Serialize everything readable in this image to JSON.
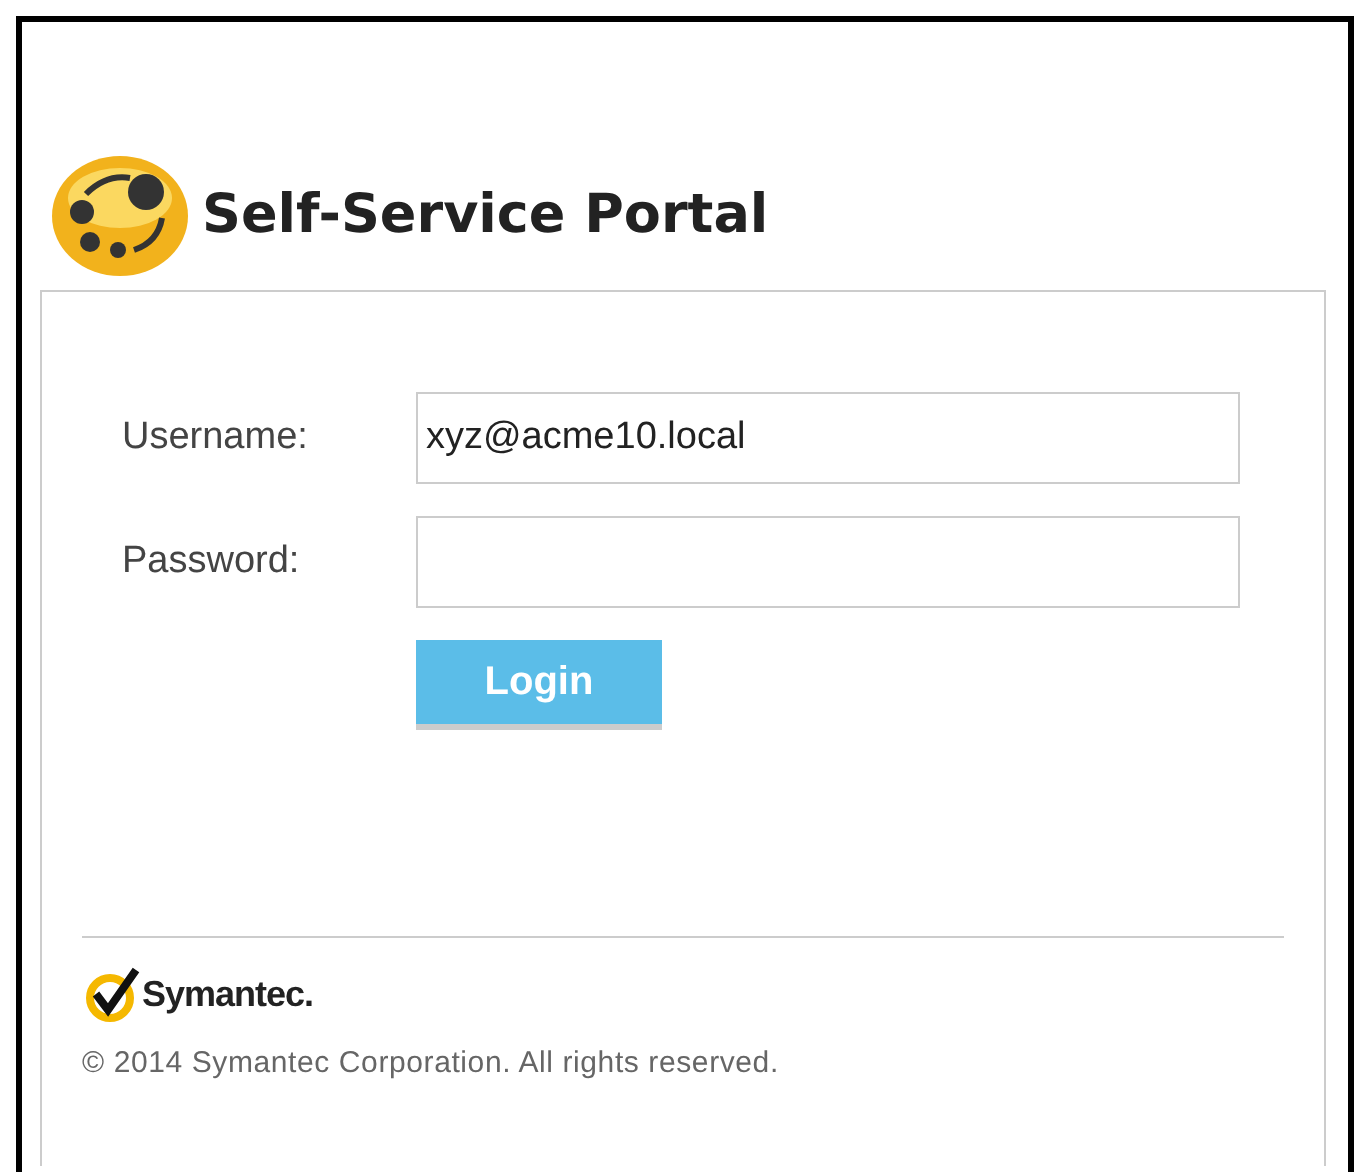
{
  "header": {
    "title": "Self-Service Portal"
  },
  "form": {
    "fields": [
      {
        "label": "Username:",
        "value": "xyz@acme10.local",
        "kind": "text"
      },
      {
        "label": "Password:",
        "kind": "password"
      }
    ],
    "button": "Login"
  },
  "footer": {
    "brand": "Symantec.",
    "copyright": "© 2014 Symantec Corporation. All rights reserved."
  }
}
